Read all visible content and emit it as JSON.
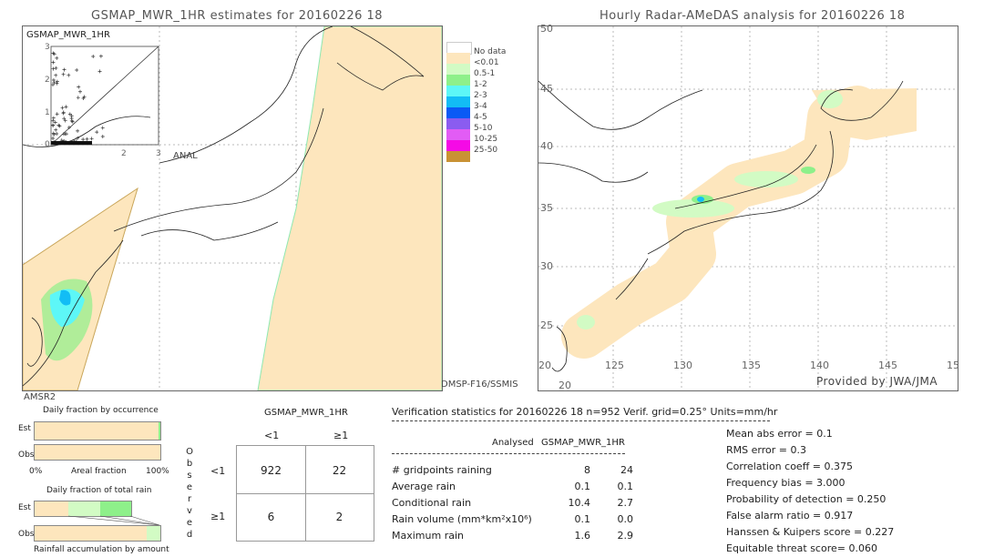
{
  "left_map": {
    "title": "GSMAP_MWR_1HR estimates for 20160226 18",
    "inset_label": "GSMAP_MWR_1HR",
    "inset_x_label": "ANAL",
    "inset_ticks": [
      "0",
      "1",
      "2",
      "3"
    ],
    "sensor_left": "AMSR2",
    "sensor_right": "DMSP-F16/SSMIS"
  },
  "right_map": {
    "title": "Hourly Radar-AMeDAS analysis for 20160226 18",
    "lon_ticks": [
      "20",
      "125",
      "130",
      "135",
      "140",
      "145",
      "15"
    ],
    "lat_ticks": [
      "45",
      "40",
      "35",
      "30",
      "25",
      "20"
    ],
    "top_tick": "50",
    "credit": "Provided by JWA/JMA"
  },
  "legend": {
    "items": [
      {
        "label": "No data",
        "color": "#ffffff"
      },
      {
        "label": "<0.01",
        "color": "#fde6bd"
      },
      {
        "label": "0.5-1",
        "color": "#d2fbc4"
      },
      {
        "label": "1-2",
        "color": "#8ef08a"
      },
      {
        "label": "2-3",
        "color": "#5df7f7"
      },
      {
        "label": "3-4",
        "color": "#12bdf5"
      },
      {
        "label": "4-5",
        "color": "#0a5af5"
      },
      {
        "label": "5-10",
        "color": "#8a5cf0"
      },
      {
        "label": "10-25",
        "color": "#e25cf5"
      },
      {
        "label": "25-50",
        "color": "#f50ae6"
      },
      {
        "label": "",
        "color": "#c99234"
      }
    ]
  },
  "fraction": {
    "occurrence_title": "Daily fraction by occurrence",
    "est": "Est",
    "obs": "Obs",
    "axis_left": "0%",
    "axis_mid": "Areal fraction",
    "axis_right": "100%",
    "total_title": "Daily fraction of total rain",
    "accum_title": "Rainfall accumulation by amount"
  },
  "contingency": {
    "header": "GSMAP_MWR_1HR",
    "col_labels": [
      "<1",
      "≥1"
    ],
    "row_labels": [
      "<1",
      "≥1"
    ],
    "side_label": "Observed",
    "cells": [
      [
        "922",
        "22"
      ],
      [
        "6",
        "2"
      ]
    ]
  },
  "stats": {
    "title": "Verification statistics for 20160226 18   n=952   Verif. grid=0.25°   Units=mm/hr",
    "col_analysed": "Analysed",
    "col_est": "GSMAP_MWR_1HR",
    "rows": [
      {
        "label": "# gridpoints raining",
        "a": "8",
        "b": "24"
      },
      {
        "label": "Average rain",
        "a": "0.1",
        "b": "0.1"
      },
      {
        "label": "Conditional rain",
        "a": "10.4",
        "b": "2.7"
      },
      {
        "label": "Rain volume (mm*km²x10⁶)",
        "a": "0.1",
        "b": "0.0"
      },
      {
        "label": "Maximum rain",
        "a": "1.6",
        "b": "2.9"
      }
    ],
    "scores": [
      "Mean abs error = 0.1",
      "RMS error = 0.3",
      "Correlation coeff = 0.375",
      "Frequency bias = 3.000",
      "Probability of detection = 0.250",
      "False alarm ratio = 0.917",
      "Hanssen & Kuipers score = 0.227",
      "Equitable threat score= 0.060"
    ]
  }
}
